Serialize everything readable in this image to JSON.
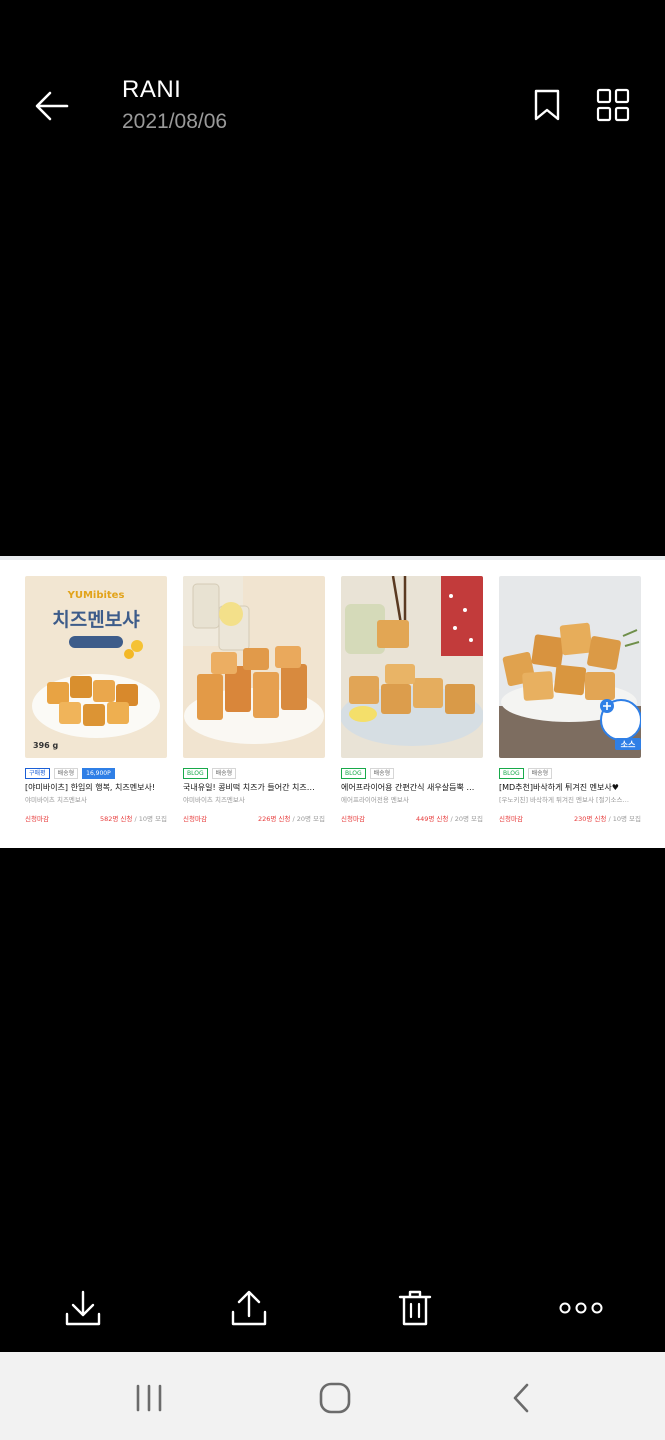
{
  "header": {
    "title": "RANI",
    "date": "2021/08/06",
    "back_icon": "back-arrow-icon",
    "bookmark_icon": "bookmark-icon",
    "grid_icon": "grid-icon"
  },
  "photo": {
    "cards": [
      {
        "tags": [
          "구매평",
          "배송형",
          "16,900P"
        ],
        "title": "[야미바이츠] 한입의 행복, 치즈멘보사!",
        "subtitle": "야미바이츠 치즈멘보사",
        "status": "신청마감",
        "count": "582명 신청",
        "quota": " / 10명 모집",
        "image_text": "치즈멘보샤",
        "image_brand": "YUMibites",
        "image_weight": "396 g"
      },
      {
        "tags": [
          "BLOG",
          "배송형"
        ],
        "title": "국내유일! 콩비떡 치즈가 들어간 치즈…",
        "subtitle": "야미바이츠 치즈멘보사",
        "status": "신청마감",
        "count": "226명 신청",
        "quota": " / 20명 모집"
      },
      {
        "tags": [
          "BLOG",
          "배송형"
        ],
        "title": "에어프라이어용 간편간식 새우살듬뿍 …",
        "subtitle": "에어프라이어전용 멘보사",
        "status": "신청마감",
        "count": "449명 신청",
        "quota": " / 20명 모집"
      },
      {
        "tags": [
          "BLOG",
          "배송형"
        ],
        "title": "[MD추천]바삭하게 튀겨진 멘보사♥",
        "subtitle": "[우노키친] 바삭하게 튀겨진 멘보사 [절기소스…",
        "status": "신청마감",
        "count": "230명 신청",
        "quota": " / 10명 모집",
        "image_badge": "소스"
      }
    ]
  },
  "toolbar": {
    "download_icon": "download-icon",
    "share_icon": "share-icon",
    "delete_icon": "trash-icon",
    "more_icon": "more-icon"
  },
  "navbar": {
    "recents_icon": "recents-icon",
    "home_icon": "home-icon",
    "back_icon": "nav-back-icon"
  }
}
